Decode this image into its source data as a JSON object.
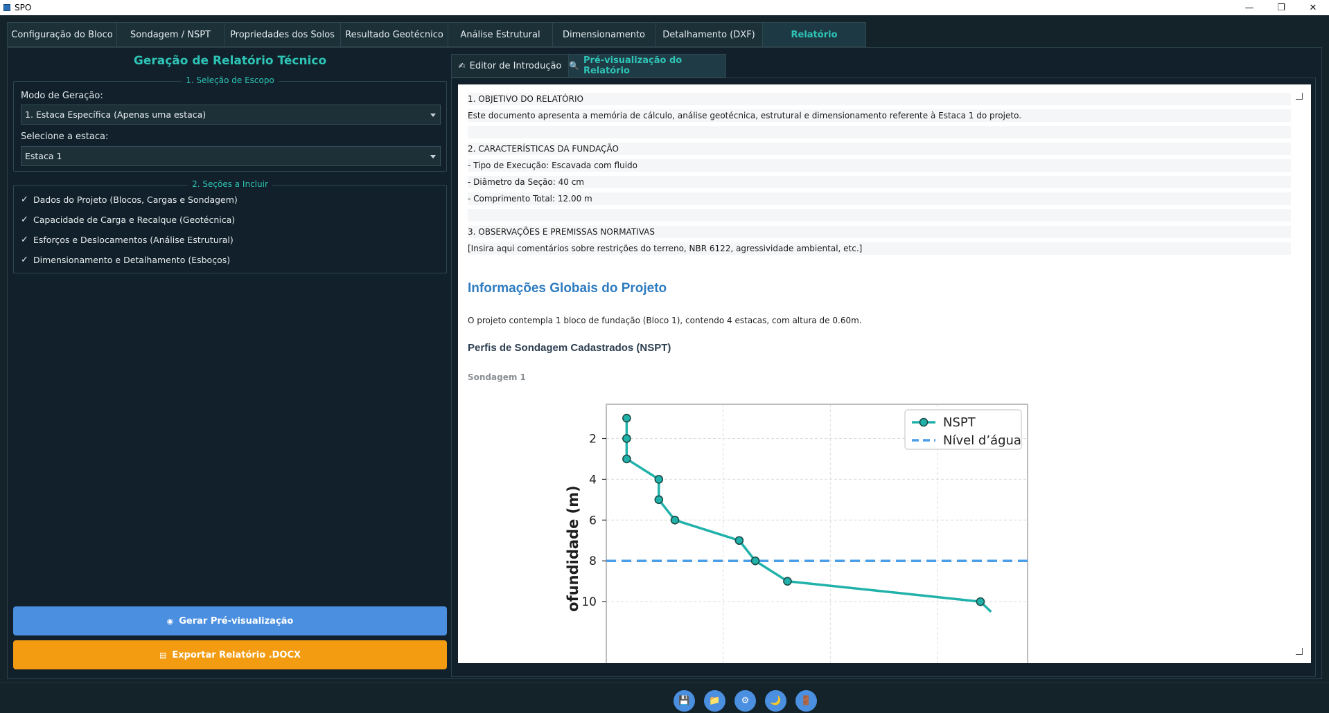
{
  "window": {
    "title": "SPO"
  },
  "main_tabs": [
    {
      "label": "Configuração do Bloco"
    },
    {
      "label": "Sondagem / NSPT"
    },
    {
      "label": "Propriedades dos Solos"
    },
    {
      "label": "Resultado Geotécnico"
    },
    {
      "label": "Análise Estrutural"
    },
    {
      "label": "Dimensionamento"
    },
    {
      "label": "Detalhamento (DXF)"
    },
    {
      "label": "Relatório"
    }
  ],
  "left": {
    "title": "Geração de Relatório Técnico",
    "scope_group": {
      "legend": "1. Seleção de Escopo",
      "mode_label": "Modo de Geração:",
      "mode_value": "1. Estaca Específica (Apenas uma estaca)",
      "pile_label": "Selecione a estaca:",
      "pile_value": "Estaca 1"
    },
    "sections_group": {
      "legend": "2. Seções a Incluir",
      "items": [
        {
          "check": "✓",
          "label": "Dados do Projeto (Blocos, Cargas e Sondagem)"
        },
        {
          "check": "✓",
          "label": "Capacidade de Carga e Recalque (Geotécnica)"
        },
        {
          "check": "✓",
          "label": "Esforços e Deslocamentos (Análise Estrutural)"
        },
        {
          "check": "✓",
          "label": "Dimensionamento e Detalhamento (Esboços)"
        }
      ]
    },
    "preview_button": "Gerar Pré-visualização",
    "export_button": "Exportar Relatório .DOCX"
  },
  "right": {
    "tabs": [
      {
        "icon": "✍",
        "label": "Editor de Introdução"
      },
      {
        "icon": "🔍",
        "label": "Pré-visualização do Relatório"
      }
    ],
    "editor_lines": [
      "1. OBJETIVO DO RELATÓRIO",
      "Este documento apresenta a memória de cálculo, análise geotécnica, estrutural e dimensionamento referente à Estaca 1 do projeto.",
      "",
      "2. CARACTERÍSTICAS DA FUNDAÇÃO",
      "- Tipo de Execução: Escavada com fluido",
      "- Diâmetro da Seção: 40 cm",
      "- Comprimento Total: 12.00 m",
      "",
      "3. OBSERVAÇÕES E PREMISSAS NORMATIVAS",
      "[Insira aqui comentários sobre restrições do terreno, NBR 6122, agressividade ambiental, etc.]"
    ],
    "global_heading": "Informações Globais do Projeto",
    "global_text": "O projeto contempla 1 bloco de fundação (Bloco 1), contendo 4 estacas, com altura de 0.60m.",
    "soundings_heading": "Perfis de Sondagem Cadastrados (NSPT)",
    "sounding_title": "Sondagem 1"
  },
  "chart_data": {
    "type": "line",
    "ylabel_visible": "ofundidade (m)",
    "y_ticks": [
      2,
      4,
      6,
      8,
      10
    ],
    "y_inverted": true,
    "grid": true,
    "legend_position": "top-right",
    "series": [
      {
        "name": "NSPT",
        "color": "#20b2aa",
        "points": [
          [
            1,
            1
          ],
          [
            1,
            2
          ],
          [
            1,
            3
          ],
          [
            4,
            4
          ],
          [
            4,
            5
          ],
          [
            5.5,
            6
          ],
          [
            11.5,
            7
          ],
          [
            13,
            8
          ],
          [
            16,
            9
          ],
          [
            34,
            10
          ],
          [
            35,
            10.5
          ]
        ]
      },
      {
        "name": "Nível d’água",
        "color": "#4a9ee8",
        "style": "dashed",
        "depth": 8
      }
    ]
  },
  "toolbar": [
    {
      "icon": "save-icon",
      "glyph": "💾"
    },
    {
      "icon": "folder-icon",
      "glyph": "📁"
    },
    {
      "icon": "settings-icon",
      "glyph": "⚙"
    },
    {
      "icon": "moon-icon",
      "glyph": "🌙"
    },
    {
      "icon": "exit-icon",
      "glyph": "🚪"
    }
  ]
}
